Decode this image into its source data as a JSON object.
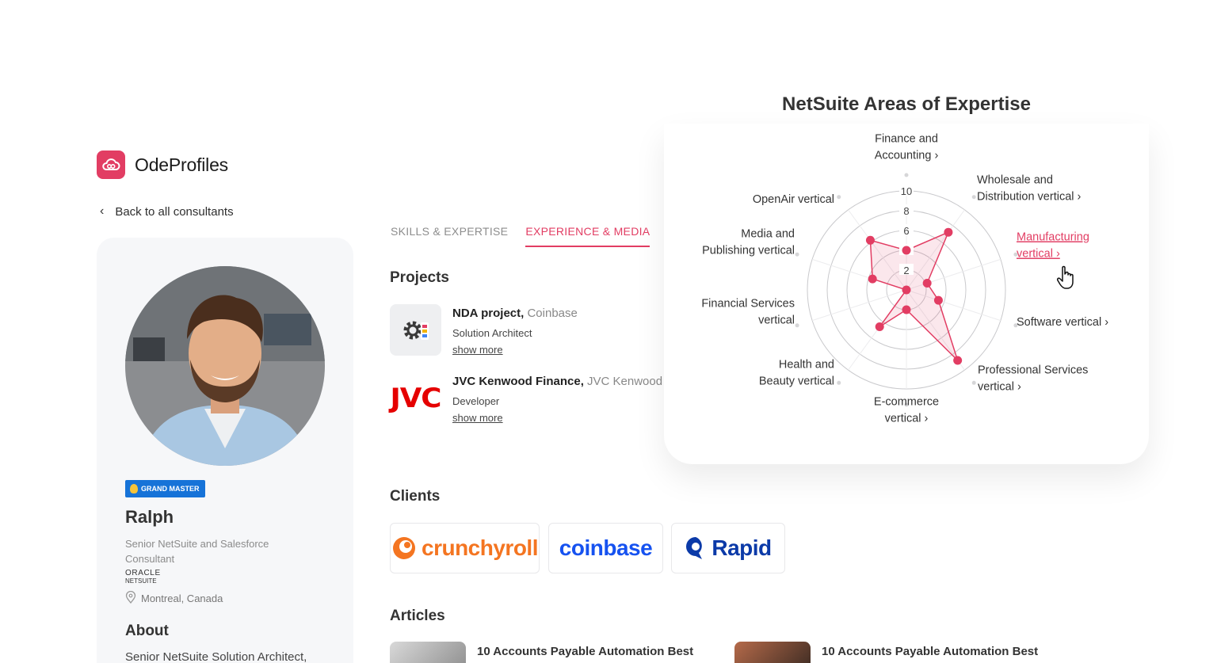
{
  "brand": {
    "name": "OdeProfiles",
    "color": "#e23d63"
  },
  "nav": {
    "back_label": "Back to all consultants"
  },
  "profile": {
    "badge": "GRAND MASTER",
    "name": "Ralph",
    "title": "Senior NetSuite and Salesforce Consultant",
    "oracle_line1": "ORACLE",
    "oracle_line2": "NETSUITE",
    "location": "Montreal, Canada",
    "about_heading": "About",
    "about_text": "Senior NetSuite Solution Architect,"
  },
  "tabs": [
    {
      "label": "SKILLS & EXPERTISE",
      "active": false
    },
    {
      "label": "EXPERIENCE & MEDIA",
      "active": true
    }
  ],
  "projects": {
    "heading": "Projects",
    "items": [
      {
        "title": "NDA project,",
        "company": "Coinbase",
        "role": "Solution Architect",
        "more": "show more"
      },
      {
        "title": "JVC Kenwood Finance,",
        "company": "JVC Kenwood",
        "role": "Developer",
        "more": "show more",
        "logo_text": "JVC"
      }
    ]
  },
  "clients": {
    "heading": "Clients",
    "items": [
      {
        "name": "crunchyroll",
        "color": "#f47521"
      },
      {
        "name": "coinbase",
        "color": "#1652f0"
      },
      {
        "name": "Rapid",
        "color": "#0b3aa8"
      }
    ]
  },
  "articles": {
    "heading": "Articles",
    "items": [
      {
        "title": "10 Accounts Payable Automation Best"
      },
      {
        "title": "10 Accounts Payable Automation Best"
      }
    ]
  },
  "chart_data": {
    "type": "radar",
    "title": "NetSuite Areas of Expertise",
    "rlim": [
      0,
      10
    ],
    "ticks": [
      2,
      4,
      6,
      8,
      10
    ],
    "grid": true,
    "series_color": "#e23d63",
    "categories": [
      {
        "label": "Finance and Accounting",
        "value": 4,
        "chevron": true,
        "highlighted": false
      },
      {
        "label": "Wholesale and Distribution vertical",
        "value": 7.2,
        "chevron": true,
        "highlighted": false
      },
      {
        "label": "Manufacturing vertical",
        "value": 2.2,
        "chevron": true,
        "highlighted": true
      },
      {
        "label": "Software vertical",
        "value": 3.4,
        "chevron": true,
        "highlighted": false
      },
      {
        "label": "Professional Services vertical",
        "value": 8.8,
        "chevron": true,
        "highlighted": false
      },
      {
        "label": "E-commerce vertical",
        "value": 2,
        "chevron": true,
        "highlighted": false
      },
      {
        "label": "Health and Beauty vertical",
        "value": 4.6,
        "chevron": false,
        "highlighted": false
      },
      {
        "label": "Financial Services vertical",
        "value": 0,
        "chevron": false,
        "highlighted": false
      },
      {
        "label": "Media and Publishing vertical",
        "value": 3.6,
        "chevron": false,
        "highlighted": false
      },
      {
        "label": "OpenAir vertical",
        "value": 6.2,
        "chevron": false,
        "highlighted": false
      }
    ]
  }
}
